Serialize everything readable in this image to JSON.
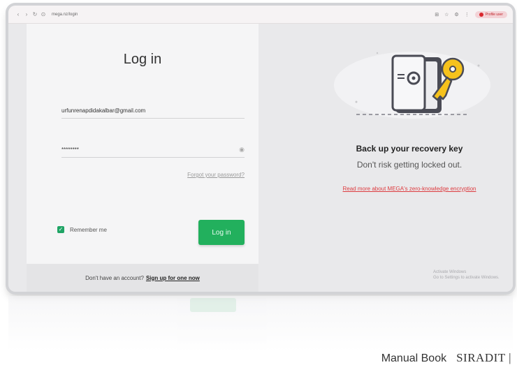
{
  "browser": {
    "url": "mega.nz/login",
    "profile": "Profile user",
    "icons": [
      "back-arrow",
      "forward-arrow",
      "reload",
      "site-info",
      "extensions",
      "bookmarks",
      "settings"
    ]
  },
  "login": {
    "title": "Log in",
    "email_value": "urfunrenapdidakalbar@gmail.com",
    "password_value": "********",
    "forgot_link": "Forgot your password?",
    "remember_label": "Remember me",
    "remember_checked": true,
    "login_button": "Log in",
    "no_account_text": "Don't have an account?",
    "signup_link": "Sign up for one now"
  },
  "promo": {
    "title": "Back up your recovery key",
    "subtitle": "Don't risk getting locked out.",
    "link": "Read more about MEGA's zero-knowledge encryption"
  },
  "watermark": {
    "line1": "Activate Windows",
    "line2": "Go to Settings to activate Windows."
  },
  "footer": {
    "manual": "Manual Book",
    "logo": "SIRADIT |"
  },
  "colors": {
    "accent_green": "#22b05d",
    "link_red": "#dd3b3f",
    "key_yellow": "#f6c21c"
  }
}
